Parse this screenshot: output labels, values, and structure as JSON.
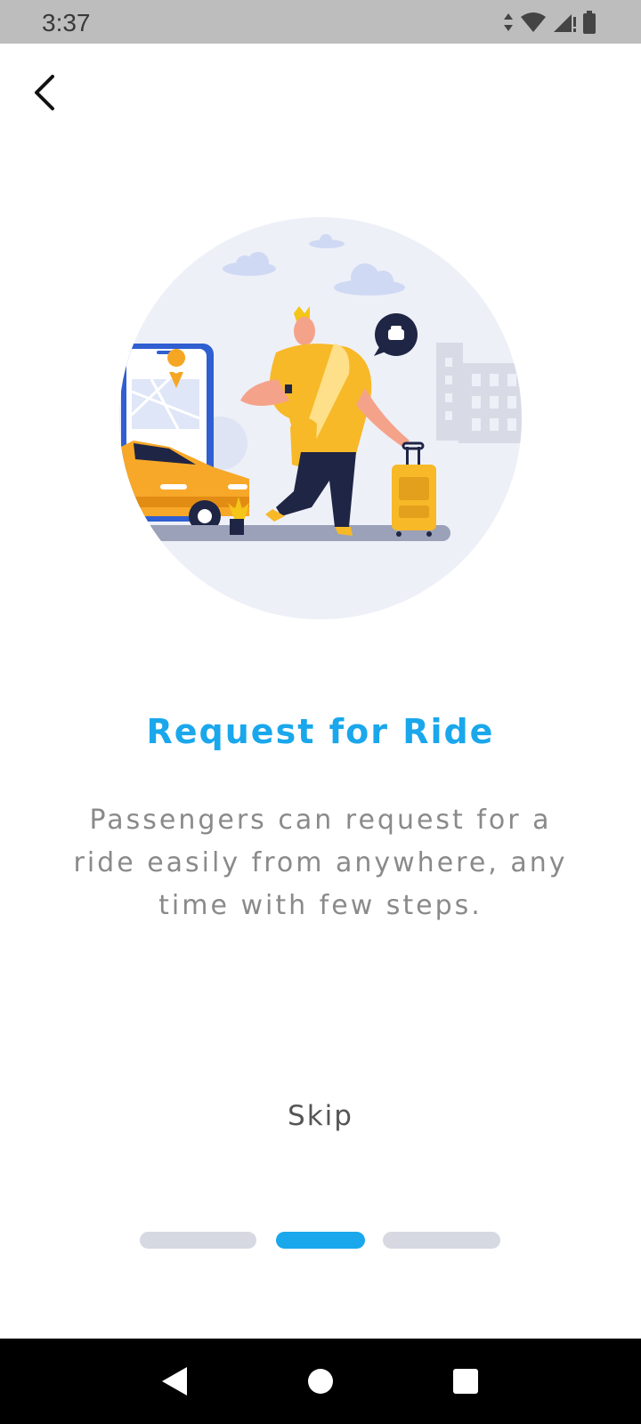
{
  "status_bar": {
    "time": "3:37",
    "icons": [
      "data-arrows-icon",
      "wifi-icon",
      "signal-icon",
      "battery-icon"
    ]
  },
  "header": {
    "back_icon": "chevron-left-icon"
  },
  "onboarding": {
    "title": "Request for Ride",
    "description": "Passengers can request for a ride easily from anywhere, any time with few steps.",
    "skip_label": "Skip",
    "page_count": 3,
    "current_page": 2
  },
  "colors": {
    "accent": "#1aa7ec",
    "inactive_dot": "#d6d8e2",
    "text_muted": "#8a8a8a",
    "status_bar": "#bdbdbd",
    "nav_bar": "#000000"
  },
  "nav_bar": {
    "icons": [
      "back-triangle-icon",
      "home-circle-icon",
      "recents-square-icon"
    ]
  }
}
